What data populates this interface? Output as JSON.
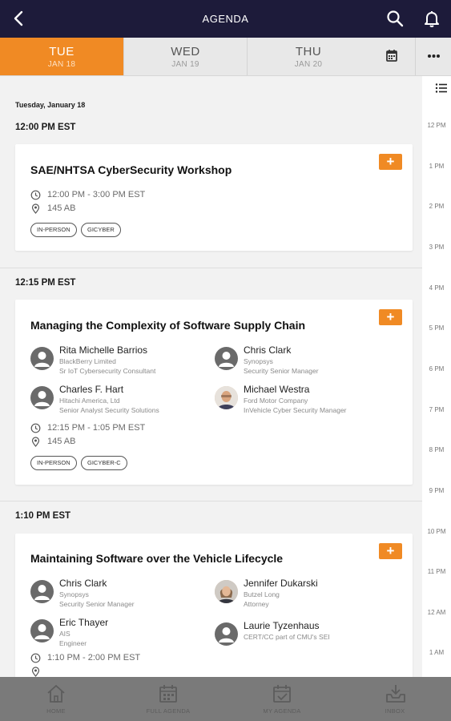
{
  "header": {
    "title": "AGENDA"
  },
  "day_tabs": [
    {
      "day": "TUE",
      "date": "JAN 18"
    },
    {
      "day": "WED",
      "date": "JAN 19"
    },
    {
      "day": "THU",
      "date": "JAN 20"
    }
  ],
  "day_heading": "Tuesday, January 18",
  "timeline": [
    "12 PM",
    "1 PM",
    "2 PM",
    "3 PM",
    "4 PM",
    "5 PM",
    "6 PM",
    "7 PM",
    "8 PM",
    "9 PM",
    "10 PM",
    "11 PM",
    "12 AM",
    "1 AM"
  ],
  "sessions": [
    {
      "time_header": "12:00 PM EST",
      "title": "SAE/NHTSA CyberSecurity Workshop",
      "add_label": "+",
      "time": "12:00 PM - 3:00 PM EST",
      "room": "145 AB",
      "tags": [
        "IN-PERSON",
        "GICYBER"
      ]
    },
    {
      "time_header": "12:15 PM EST",
      "title": "Managing the Complexity of Software Supply Chain",
      "add_label": "+",
      "speakers": [
        {
          "name": "Rita Michelle Barrios",
          "org": "BlackBerry Limited",
          "role": "Sr IoT Cybersecurity Consultant"
        },
        {
          "name": "Chris Clark",
          "org": "Synopsys",
          "role": "Security Senior Manager"
        },
        {
          "name": "Charles F. Hart",
          "org": "Hitachi America, Ltd",
          "role": "Senior Analyst Security Solutions"
        },
        {
          "name": "Michael Westra",
          "org": "Ford Motor Company",
          "role": "InVehicle Cyber Security Manager"
        }
      ],
      "time": "12:15 PM - 1:05 PM EST",
      "room": "145 AB",
      "tags": [
        "IN-PERSON",
        "GICYBER-C"
      ]
    },
    {
      "time_header": "1:10 PM EST",
      "title": "Maintaining Software over the Vehicle Lifecycle",
      "add_label": "+",
      "speakers": [
        {
          "name": "Chris Clark",
          "org": "Synopsys",
          "role": "Security Senior Manager"
        },
        {
          "name": "Jennifer Dukarski",
          "org": "Butzel Long",
          "role": "Attorney"
        },
        {
          "name": "Eric Thayer",
          "org": "AIS",
          "role": "Engineer"
        },
        {
          "name": "Laurie Tyzenhaus",
          "org": "CERT/CC part of CMU's SEI",
          "role": ""
        }
      ],
      "time": "1:10 PM - 2:00 PM EST"
    }
  ],
  "bottom_nav": [
    {
      "label": "HOME",
      "icon": "home-icon"
    },
    {
      "label": "FULL AGENDA",
      "icon": "calendar-icon"
    },
    {
      "label": "MY AGENDA",
      "icon": "calendar-check-icon"
    },
    {
      "label": "INBOX",
      "icon": "inbox-download-icon"
    }
  ],
  "colors": {
    "header": "#1d1b3a",
    "accent": "#f08a24",
    "bottom_nav": "#7a7a7a"
  }
}
